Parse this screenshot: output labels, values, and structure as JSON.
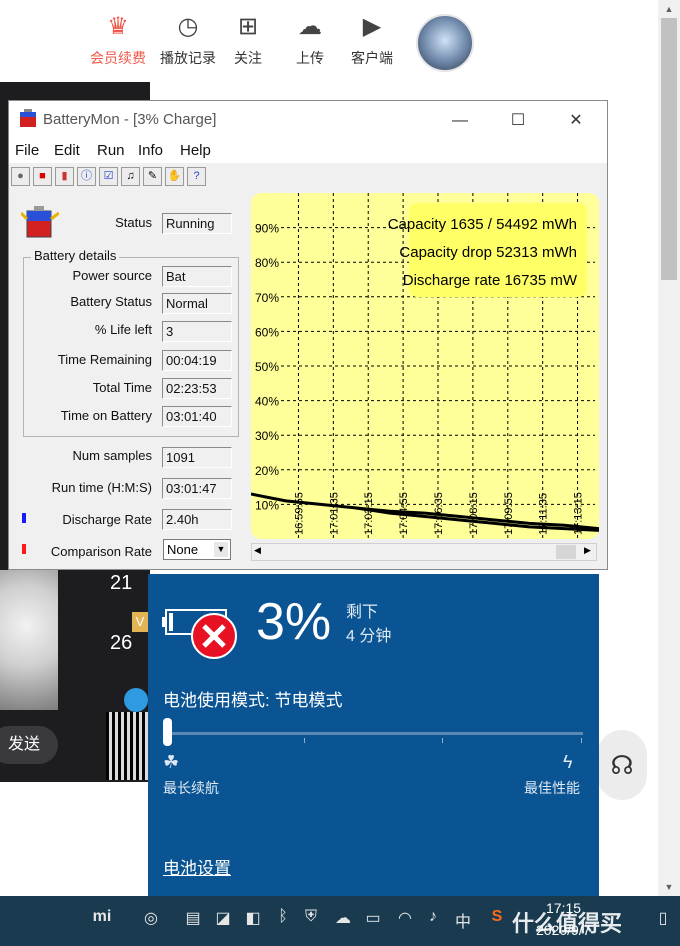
{
  "top_nav": {
    "items": [
      {
        "label": "会员续费",
        "icon": "crown-icon",
        "accent": "#f0594a"
      },
      {
        "label": "播放记录",
        "icon": "clock-icon"
      },
      {
        "label": "关注",
        "icon": "bookmark-plus-icon"
      },
      {
        "label": "上传",
        "icon": "cloud-upload-icon"
      },
      {
        "label": "客户端",
        "icon": "play-screen-icon"
      }
    ]
  },
  "bg_page": {
    "send_label": "发送",
    "num1": "21",
    "num2": "26",
    "badge": "V"
  },
  "batterymon": {
    "title": "BatteryMon - [3% Charge]",
    "menu": [
      "File",
      "Edit",
      "Run",
      "Info",
      "Help"
    ],
    "status_label": "Status",
    "status_value": "Running",
    "group_label": "Battery details",
    "fields": [
      {
        "label": "Power source",
        "value": "Bat"
      },
      {
        "label": "Battery Status",
        "value": "Normal"
      },
      {
        "label": "% Life left",
        "value": "3"
      },
      {
        "label": "Time Remaining",
        "value": "00:04:19"
      },
      {
        "label": "Total Time",
        "value": "02:23:53"
      },
      {
        "label": "Time on Battery",
        "value": "03:01:40"
      }
    ],
    "num_samples_label": "Num samples",
    "num_samples_value": "1091",
    "run_time_label": "Run time (H:M:S)",
    "run_time_value": "03:01:47",
    "discharge_label": "Discharge Rate",
    "discharge_value": "2.40h",
    "discharge_color": "#1a1aff",
    "comparison_label": "Comparison Rate",
    "comparison_value": "None",
    "comparison_color": "#ff1a1a"
  },
  "chart_data": {
    "type": "line",
    "info_lines": [
      "Capacity 1635 / 54492 mWh",
      "Capacity drop 52313 mWh",
      "Discharge rate 16735 mW"
    ],
    "ylim": [
      0,
      100
    ],
    "y_ticks": [
      "90%",
      "80%",
      "70%",
      "60%",
      "50%",
      "40%",
      "30%",
      "20%",
      "10%"
    ],
    "x_ticks": [
      "16:59:55",
      "17:01:35",
      "17:03:15",
      "17:04:55",
      "17:06:35",
      "17:08:15",
      "17:09:55",
      "17:11:35",
      "17:13:15"
    ],
    "grid": true,
    "background": "#ffff99",
    "series": [
      {
        "values": [
          [
            0,
            13
          ],
          [
            0.05,
            12
          ],
          [
            0.1,
            11
          ],
          [
            0.2,
            10
          ],
          [
            0.3,
            9
          ],
          [
            0.4,
            8
          ],
          [
            0.5,
            7.5
          ],
          [
            0.6,
            6.5
          ],
          [
            0.7,
            5.5
          ],
          [
            0.8,
            4.5
          ],
          [
            0.9,
            4
          ],
          [
            1,
            3
          ]
        ],
        "color": "#000000"
      },
      {
        "values": [
          [
            0.3,
            9
          ],
          [
            0.4,
            7.5
          ],
          [
            0.5,
            6.5
          ],
          [
            0.6,
            5.5
          ],
          [
            0.7,
            4.5
          ],
          [
            0.8,
            3.5
          ],
          [
            0.9,
            3
          ],
          [
            1,
            2.5
          ]
        ],
        "color": "#000000"
      }
    ]
  },
  "flyout": {
    "percent": "3%",
    "remain_label": "剩下",
    "remain_time": "4 分钟",
    "mode_label": "电池使用模式: 节电模式",
    "slider_level": 0,
    "left_label": "最长续航",
    "right_label": "最佳性能",
    "settings_link": "电池设置"
  },
  "taskbar": {
    "time": "17:15",
    "date": "2020/9/7",
    "ime": "中",
    "watermark": "什么值得买"
  }
}
